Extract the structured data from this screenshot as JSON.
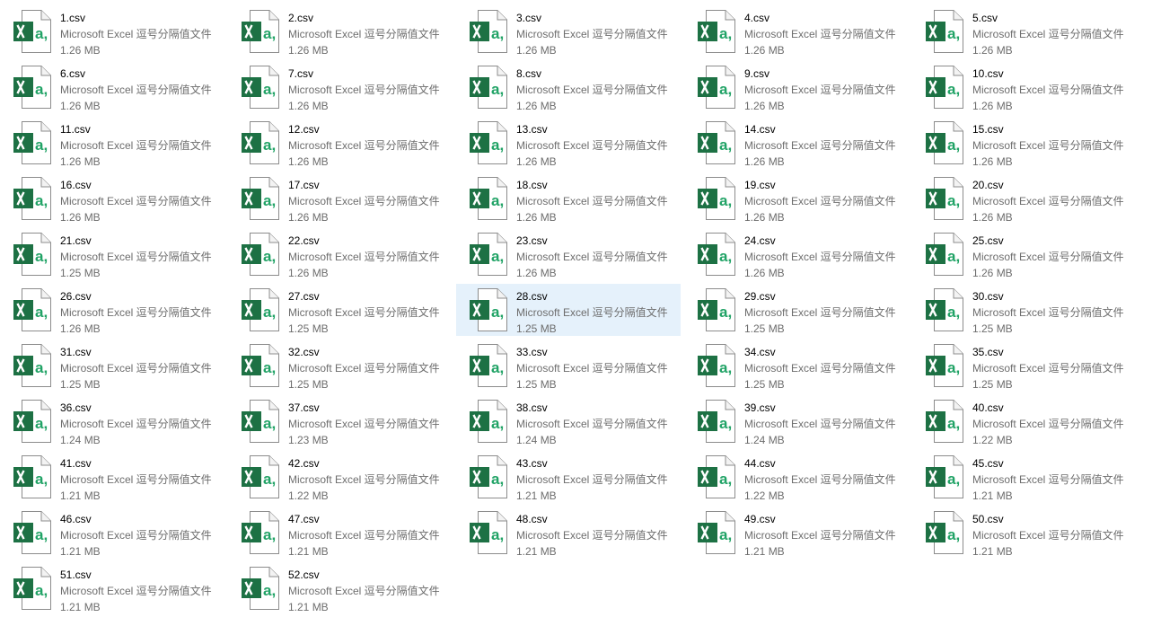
{
  "view": {
    "mode": "tiles",
    "selected_item": "28.csv",
    "colors": {
      "selected_background": "#e5f1fb",
      "excel_green": "#1d7144",
      "excel_light_green": "#21a366",
      "secondary_text": "#6d6d6d"
    }
  },
  "files": [
    {
      "name": "1.csv",
      "type": "Microsoft Excel 逗号分隔值文件",
      "size": "1.26 MB",
      "icon": "excel-csv-icon"
    },
    {
      "name": "2.csv",
      "type": "Microsoft Excel 逗号分隔值文件",
      "size": "1.26 MB",
      "icon": "excel-csv-icon"
    },
    {
      "name": "3.csv",
      "type": "Microsoft Excel 逗号分隔值文件",
      "size": "1.26 MB",
      "icon": "excel-csv-icon"
    },
    {
      "name": "4.csv",
      "type": "Microsoft Excel 逗号分隔值文件",
      "size": "1.26 MB",
      "icon": "excel-csv-icon"
    },
    {
      "name": "5.csv",
      "type": "Microsoft Excel 逗号分隔值文件",
      "size": "1.26 MB",
      "icon": "excel-csv-icon"
    },
    {
      "name": "6.csv",
      "type": "Microsoft Excel 逗号分隔值文件",
      "size": "1.26 MB",
      "icon": "excel-csv-icon"
    },
    {
      "name": "7.csv",
      "type": "Microsoft Excel 逗号分隔值文件",
      "size": "1.26 MB",
      "icon": "excel-csv-icon"
    },
    {
      "name": "8.csv",
      "type": "Microsoft Excel 逗号分隔值文件",
      "size": "1.26 MB",
      "icon": "excel-csv-icon"
    },
    {
      "name": "9.csv",
      "type": "Microsoft Excel 逗号分隔值文件",
      "size": "1.26 MB",
      "icon": "excel-csv-icon"
    },
    {
      "name": "10.csv",
      "type": "Microsoft Excel 逗号分隔值文件",
      "size": "1.26 MB",
      "icon": "excel-csv-icon"
    },
    {
      "name": "11.csv",
      "type": "Microsoft Excel 逗号分隔值文件",
      "size": "1.26 MB",
      "icon": "excel-csv-icon"
    },
    {
      "name": "12.csv",
      "type": "Microsoft Excel 逗号分隔值文件",
      "size": "1.26 MB",
      "icon": "excel-csv-icon"
    },
    {
      "name": "13.csv",
      "type": "Microsoft Excel 逗号分隔值文件",
      "size": "1.26 MB",
      "icon": "excel-csv-icon"
    },
    {
      "name": "14.csv",
      "type": "Microsoft Excel 逗号分隔值文件",
      "size": "1.26 MB",
      "icon": "excel-csv-icon"
    },
    {
      "name": "15.csv",
      "type": "Microsoft Excel 逗号分隔值文件",
      "size": "1.26 MB",
      "icon": "excel-csv-icon"
    },
    {
      "name": "16.csv",
      "type": "Microsoft Excel 逗号分隔值文件",
      "size": "1.26 MB",
      "icon": "excel-csv-icon"
    },
    {
      "name": "17.csv",
      "type": "Microsoft Excel 逗号分隔值文件",
      "size": "1.26 MB",
      "icon": "excel-csv-icon"
    },
    {
      "name": "18.csv",
      "type": "Microsoft Excel 逗号分隔值文件",
      "size": "1.26 MB",
      "icon": "excel-csv-icon"
    },
    {
      "name": "19.csv",
      "type": "Microsoft Excel 逗号分隔值文件",
      "size": "1.26 MB",
      "icon": "excel-csv-icon"
    },
    {
      "name": "20.csv",
      "type": "Microsoft Excel 逗号分隔值文件",
      "size": "1.26 MB",
      "icon": "excel-csv-icon"
    },
    {
      "name": "21.csv",
      "type": "Microsoft Excel 逗号分隔值文件",
      "size": "1.25 MB",
      "icon": "excel-csv-icon"
    },
    {
      "name": "22.csv",
      "type": "Microsoft Excel 逗号分隔值文件",
      "size": "1.26 MB",
      "icon": "excel-csv-icon"
    },
    {
      "name": "23.csv",
      "type": "Microsoft Excel 逗号分隔值文件",
      "size": "1.26 MB",
      "icon": "excel-csv-icon"
    },
    {
      "name": "24.csv",
      "type": "Microsoft Excel 逗号分隔值文件",
      "size": "1.26 MB",
      "icon": "excel-csv-icon"
    },
    {
      "name": "25.csv",
      "type": "Microsoft Excel 逗号分隔值文件",
      "size": "1.26 MB",
      "icon": "excel-csv-icon"
    },
    {
      "name": "26.csv",
      "type": "Microsoft Excel 逗号分隔值文件",
      "size": "1.26 MB",
      "icon": "excel-csv-icon"
    },
    {
      "name": "27.csv",
      "type": "Microsoft Excel 逗号分隔值文件",
      "size": "1.25 MB",
      "icon": "excel-csv-icon"
    },
    {
      "name": "28.csv",
      "type": "Microsoft Excel 逗号分隔值文件",
      "size": "1.25 MB",
      "icon": "excel-csv-icon",
      "selected": true
    },
    {
      "name": "29.csv",
      "type": "Microsoft Excel 逗号分隔值文件",
      "size": "1.25 MB",
      "icon": "excel-csv-icon"
    },
    {
      "name": "30.csv",
      "type": "Microsoft Excel 逗号分隔值文件",
      "size": "1.25 MB",
      "icon": "excel-csv-icon"
    },
    {
      "name": "31.csv",
      "type": "Microsoft Excel 逗号分隔值文件",
      "size": "1.25 MB",
      "icon": "excel-csv-icon"
    },
    {
      "name": "32.csv",
      "type": "Microsoft Excel 逗号分隔值文件",
      "size": "1.25 MB",
      "icon": "excel-csv-icon"
    },
    {
      "name": "33.csv",
      "type": "Microsoft Excel 逗号分隔值文件",
      "size": "1.25 MB",
      "icon": "excel-csv-icon"
    },
    {
      "name": "34.csv",
      "type": "Microsoft Excel 逗号分隔值文件",
      "size": "1.25 MB",
      "icon": "excel-csv-icon"
    },
    {
      "name": "35.csv",
      "type": "Microsoft Excel 逗号分隔值文件",
      "size": "1.25 MB",
      "icon": "excel-csv-icon"
    },
    {
      "name": "36.csv",
      "type": "Microsoft Excel 逗号分隔值文件",
      "size": "1.24 MB",
      "icon": "excel-csv-icon"
    },
    {
      "name": "37.csv",
      "type": "Microsoft Excel 逗号分隔值文件",
      "size": "1.23 MB",
      "icon": "excel-csv-icon"
    },
    {
      "name": "38.csv",
      "type": "Microsoft Excel 逗号分隔值文件",
      "size": "1.24 MB",
      "icon": "excel-csv-icon"
    },
    {
      "name": "39.csv",
      "type": "Microsoft Excel 逗号分隔值文件",
      "size": "1.24 MB",
      "icon": "excel-csv-icon"
    },
    {
      "name": "40.csv",
      "type": "Microsoft Excel 逗号分隔值文件",
      "size": "1.22 MB",
      "icon": "excel-csv-icon"
    },
    {
      "name": "41.csv",
      "type": "Microsoft Excel 逗号分隔值文件",
      "size": "1.21 MB",
      "icon": "excel-csv-icon"
    },
    {
      "name": "42.csv",
      "type": "Microsoft Excel 逗号分隔值文件",
      "size": "1.22 MB",
      "icon": "excel-csv-icon"
    },
    {
      "name": "43.csv",
      "type": "Microsoft Excel 逗号分隔值文件",
      "size": "1.21 MB",
      "icon": "excel-csv-icon"
    },
    {
      "name": "44.csv",
      "type": "Microsoft Excel 逗号分隔值文件",
      "size": "1.22 MB",
      "icon": "excel-csv-icon"
    },
    {
      "name": "45.csv",
      "type": "Microsoft Excel 逗号分隔值文件",
      "size": "1.21 MB",
      "icon": "excel-csv-icon"
    },
    {
      "name": "46.csv",
      "type": "Microsoft Excel 逗号分隔值文件",
      "size": "1.21 MB",
      "icon": "excel-csv-icon"
    },
    {
      "name": "47.csv",
      "type": "Microsoft Excel 逗号分隔值文件",
      "size": "1.21 MB",
      "icon": "excel-csv-icon"
    },
    {
      "name": "48.csv",
      "type": "Microsoft Excel 逗号分隔值文件",
      "size": "1.21 MB",
      "icon": "excel-csv-icon"
    },
    {
      "name": "49.csv",
      "type": "Microsoft Excel 逗号分隔值文件",
      "size": "1.21 MB",
      "icon": "excel-csv-icon"
    },
    {
      "name": "50.csv",
      "type": "Microsoft Excel 逗号分隔值文件",
      "size": "1.21 MB",
      "icon": "excel-csv-icon"
    },
    {
      "name": "51.csv",
      "type": "Microsoft Excel 逗号分隔值文件",
      "size": "1.21 MB",
      "icon": "excel-csv-icon"
    },
    {
      "name": "52.csv",
      "type": "Microsoft Excel 逗号分隔值文件",
      "size": "1.21 MB",
      "icon": "excel-csv-icon"
    }
  ]
}
